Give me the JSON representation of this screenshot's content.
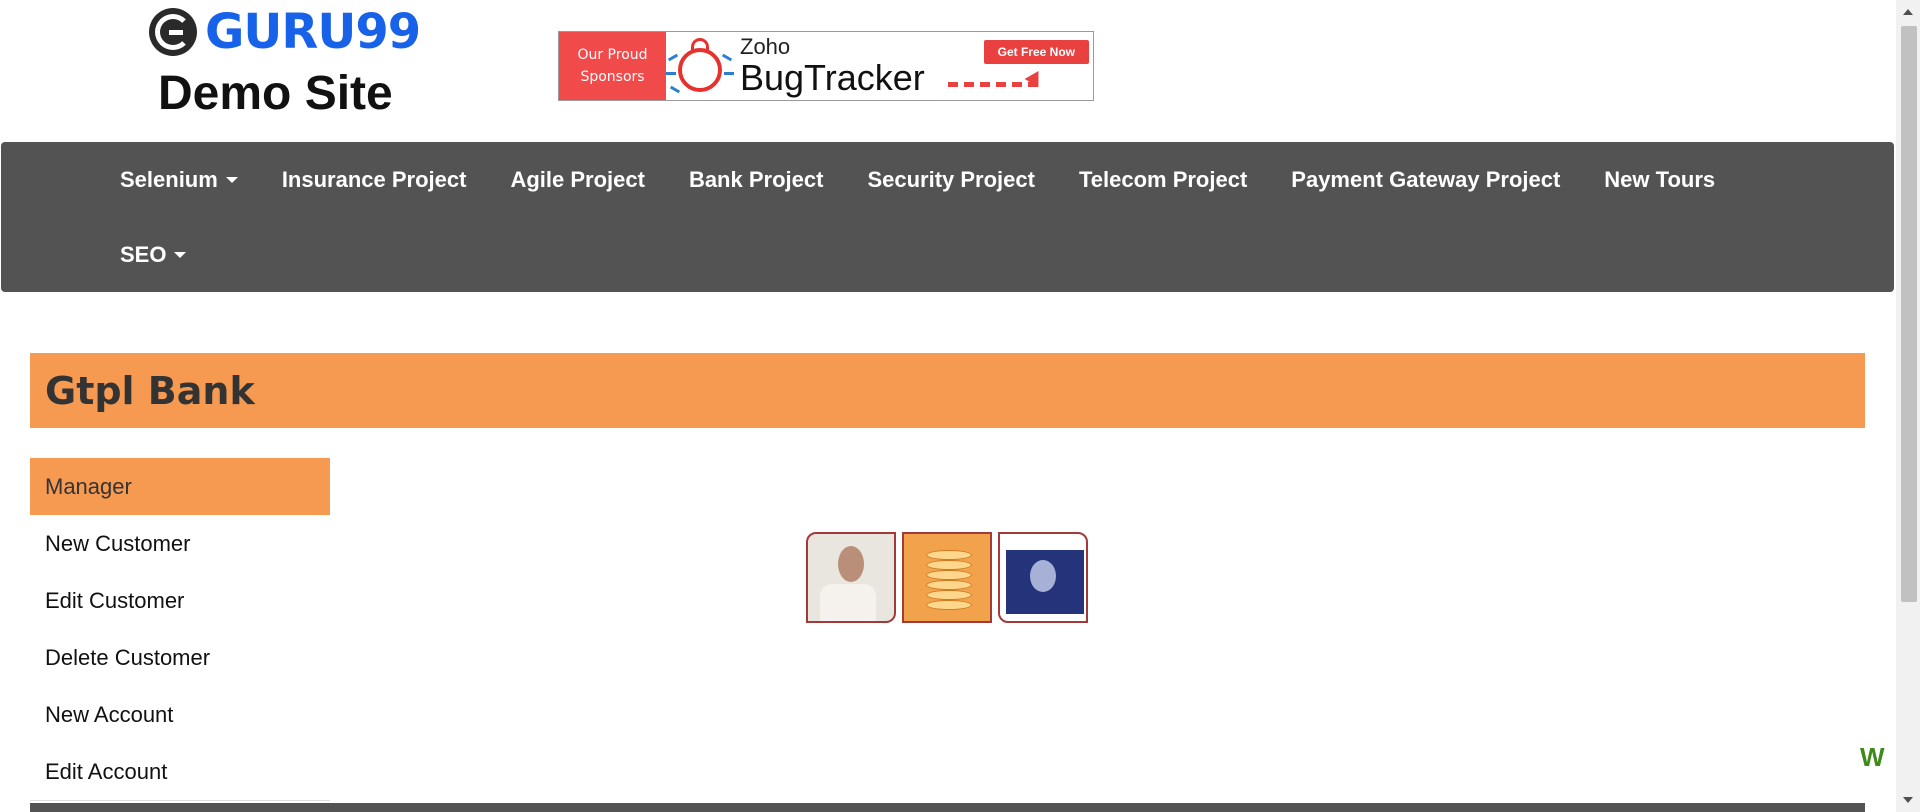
{
  "header": {
    "logo_text": "GURU99",
    "logo_subtitle": "Demo Site",
    "sponsor_banner": {
      "left_line1": "Our Proud",
      "left_line2": "Sponsors",
      "brand": "Zoho",
      "product": "BugTracker",
      "cta": "Get Free Now"
    }
  },
  "nav": {
    "row1": [
      {
        "label": "Selenium",
        "dropdown": true
      },
      {
        "label": "Insurance Project",
        "dropdown": false
      },
      {
        "label": "Agile Project",
        "dropdown": false
      },
      {
        "label": "Bank Project",
        "dropdown": false
      },
      {
        "label": "Security Project",
        "dropdown": false
      },
      {
        "label": "Telecom Project",
        "dropdown": false
      },
      {
        "label": "Payment Gateway Project",
        "dropdown": false
      },
      {
        "label": "New Tours",
        "dropdown": false
      }
    ],
    "row2": [
      {
        "label": "SEO",
        "dropdown": true
      }
    ]
  },
  "page": {
    "bank_title": "Gtpl Bank"
  },
  "sidebar": {
    "items": [
      {
        "label": "Manager",
        "active": true
      },
      {
        "label": "New Customer",
        "active": false
      },
      {
        "label": "Edit Customer",
        "active": false
      },
      {
        "label": "Delete Customer",
        "active": false
      },
      {
        "label": "New Account",
        "active": false
      },
      {
        "label": "Edit Account",
        "active": false
      }
    ]
  },
  "marquee": {
    "text": "W"
  },
  "colors": {
    "nav_bg": "#535353",
    "accent_orange": "#f79a51",
    "logo_blue": "#1762e8",
    "marquee_green": "#3f8a1a"
  }
}
